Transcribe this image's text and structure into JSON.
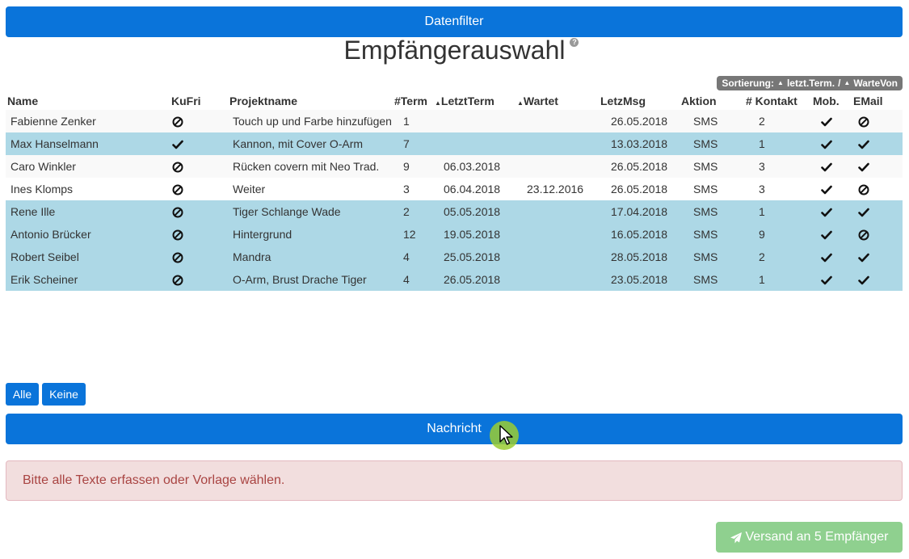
{
  "header": {
    "datenfilter_label": "Datenfilter",
    "title": "Empfängerauswahl",
    "help_glyph": "?"
  },
  "sort": {
    "label": "Sortierung:",
    "key1": "letzt.Term.",
    "separator": "/",
    "key2": "WarteVon"
  },
  "table": {
    "columns": {
      "name": "Name",
      "kufri": "KuFri",
      "projekt": "Projektname",
      "term": "#Term",
      "letzt": "LetztTerm",
      "wartet": "Wartet",
      "msg": "LetzMsg",
      "aktion": "Aktion",
      "kontakt": "# Kontakt",
      "mob": "Mob.",
      "email": "EMail"
    },
    "rows": [
      {
        "name": "Fabienne Zenker",
        "kufri": "no",
        "projekt": "Touch up und Farbe hinzufügen",
        "term": "1",
        "letzt": "",
        "wartet": "",
        "msg": "26.05.2018",
        "aktion": "SMS",
        "kontakt": "2",
        "mob": "yes",
        "email": "no",
        "style": "white"
      },
      {
        "name": "Max Hanselmann",
        "kufri": "yes",
        "projekt": "Kannon, mit Cover O-Arm",
        "term": "7",
        "letzt": "",
        "wartet": "",
        "msg": "13.03.2018",
        "aktion": "SMS",
        "kontakt": "1",
        "mob": "yes",
        "email": "yes",
        "style": "blue"
      },
      {
        "name": "Caro Winkler",
        "kufri": "no",
        "projekt": "Rücken covern mit Neo Trad.",
        "term": "9",
        "letzt": "06.03.2018",
        "wartet": "",
        "msg": "26.05.2018",
        "aktion": "SMS",
        "kontakt": "3",
        "mob": "yes",
        "email": "yes",
        "style": "white"
      },
      {
        "name": "Ines Klomps",
        "kufri": "no",
        "projekt": "Weiter",
        "term": "3",
        "letzt": "06.04.2018",
        "wartet": "23.12.2016",
        "msg": "26.05.2018",
        "aktion": "SMS",
        "kontakt": "3",
        "mob": "yes",
        "email": "no",
        "style": "white-alt"
      },
      {
        "name": "Rene Ille",
        "kufri": "no",
        "projekt": "Tiger Schlange Wade",
        "term": "2",
        "letzt": "05.05.2018",
        "wartet": "",
        "msg": "17.04.2018",
        "aktion": "SMS",
        "kontakt": "1",
        "mob": "yes",
        "email": "yes",
        "style": "blue"
      },
      {
        "name": "Antonio Brücker",
        "kufri": "no",
        "projekt": "Hintergrund",
        "term": "12",
        "letzt": "19.05.2018",
        "wartet": "",
        "msg": "16.05.2018",
        "aktion": "SMS",
        "kontakt": "9",
        "mob": "yes",
        "email": "no",
        "style": "blue"
      },
      {
        "name": "Robert Seibel",
        "kufri": "no",
        "projekt": "Mandra",
        "term": "4",
        "letzt": "25.05.2018",
        "wartet": "",
        "msg": "28.05.2018",
        "aktion": "SMS",
        "kontakt": "2",
        "mob": "yes",
        "email": "yes",
        "style": "blue"
      },
      {
        "name": "Erik Scheiner",
        "kufri": "no",
        "projekt": "O-Arm, Brust Drache Tiger",
        "term": "4",
        "letzt": "26.05.2018",
        "wartet": "",
        "msg": "23.05.2018",
        "aktion": "SMS",
        "kontakt": "1",
        "mob": "yes",
        "email": "yes",
        "style": "blue"
      }
    ]
  },
  "buttons": {
    "alle": "Alle",
    "keine": "Keine",
    "nachricht": "Nachricht",
    "send": "Versand an 5 Empfänger"
  },
  "alert": {
    "text": "Bitte alle Texte erfassen oder Vorlage wählen."
  },
  "colors": {
    "primary": "#0a74da",
    "row_blue": "#add8e6",
    "alert_bg": "#f2dede",
    "alert_text": "#a94442",
    "send_bg": "#8fd08f"
  },
  "icons": {
    "yes": "check-icon",
    "no": "ban-icon",
    "send": "paper-plane-icon",
    "help": "question-circle-icon"
  }
}
